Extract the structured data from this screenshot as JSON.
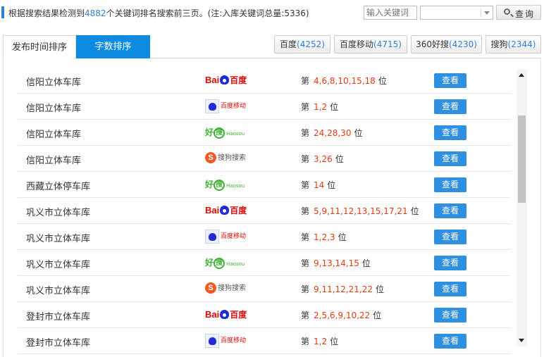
{
  "header": {
    "summary_prefix": "根据搜索结果检测到",
    "summary_count": "4882",
    "summary_suffix": "个关键词排名搜索前三页。(注:入库关键词总量:5336)",
    "keyword_placeholder": "输入关键词",
    "select_value": "",
    "search_label": "查询"
  },
  "tabs": {
    "sort_time": "发布时间排序",
    "sort_count": "字数排序",
    "active": "sort_count"
  },
  "engines": [
    {
      "name": "百度",
      "count": "(4252)"
    },
    {
      "name": "百度移动",
      "count": "(4715)"
    },
    {
      "name": "360好搜",
      "count": "(4230)"
    },
    {
      "name": "搜狗",
      "count": "(2344)"
    }
  ],
  "logos": {
    "baidu_text_1": "Bai",
    "baidu_text_2": "百度",
    "mbaidu_text": "百度移动",
    "haosou_text_1": "好",
    "haosou_text_2": "搜",
    "haosou_text_3": "Haosou",
    "sogou_letter": "S",
    "sogou_text": "搜狗搜索"
  },
  "rank_prefix": "第",
  "rank_suffix": "位",
  "view_label": "查看",
  "rows": [
    {
      "keyword": "信阳立体车库",
      "engine": "baidu",
      "positions": "4,6,8,10,15,18"
    },
    {
      "keyword": "信阳立体车库",
      "engine": "baidu-mobile",
      "positions": "1,2"
    },
    {
      "keyword": "信阳立体车库",
      "engine": "haosou",
      "positions": "24,28,30"
    },
    {
      "keyword": "信阳立体车库",
      "engine": "sogou",
      "positions": "3,26"
    },
    {
      "keyword": "西藏立体停车库",
      "engine": "haosou",
      "positions": "14"
    },
    {
      "keyword": "巩义市立体车库",
      "engine": "baidu",
      "positions": "5,9,11,12,13,15,17,21"
    },
    {
      "keyword": "巩义市立体车库",
      "engine": "baidu-mobile",
      "positions": "1,2,3"
    },
    {
      "keyword": "巩义市立体车库",
      "engine": "haosou",
      "positions": "9,13,14,15"
    },
    {
      "keyword": "巩义市立体车库",
      "engine": "sogou",
      "positions": "9,11,12,21,22"
    },
    {
      "keyword": "登封市立体车库",
      "engine": "baidu",
      "positions": "2,5,6,9,10,22"
    },
    {
      "keyword": "登封市立体车库",
      "engine": "baidu-mobile",
      "positions": "1,2"
    }
  ],
  "colors": {
    "accent": "#0c8be0",
    "count_blue": "#2f7fd6",
    "rank_red": "#e23a15",
    "view_button": "#2f8fe0"
  }
}
